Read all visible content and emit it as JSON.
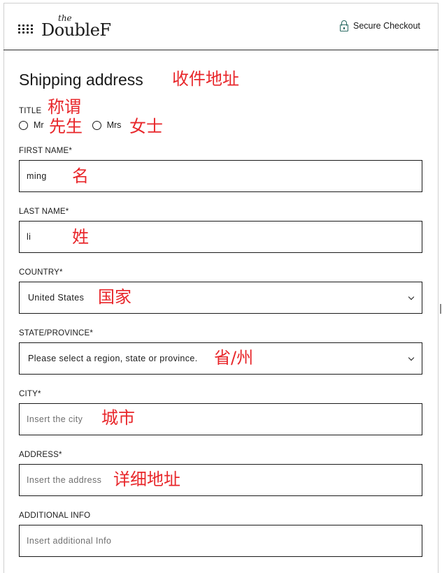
{
  "header": {
    "logo_the": "the",
    "logo_main": "DoubleF",
    "secure_label": "Secure Checkout",
    "icons": [
      "menu-dots-icon",
      "lock-icon"
    ]
  },
  "form": {
    "title": "Shipping address",
    "title_field": {
      "label": "TITLE",
      "options": [
        "Mr",
        "Mrs"
      ]
    },
    "first_name": {
      "label": "FIRST NAME*",
      "value": "ming"
    },
    "last_name": {
      "label": "LAST NAME*",
      "value": "li"
    },
    "country": {
      "label": "COUNTRY*",
      "value": "United States"
    },
    "state": {
      "label": "STATE/PROVINCE*",
      "value": "Please select a region, state or province."
    },
    "city": {
      "label": "CITY*",
      "placeholder": "Insert the city"
    },
    "address": {
      "label": "ADDRESS*",
      "placeholder": "Insert the address"
    },
    "additional": {
      "label": "ADDITIONAL INFO",
      "placeholder": "Insert additional Info"
    }
  },
  "annotations": {
    "title": "收件地址",
    "title_field": "称谓",
    "mr": "先生",
    "mrs": "女士",
    "first_name": "名",
    "last_name": "姓",
    "country": "国家",
    "state": "省/州",
    "city": "城市",
    "address": "详细地址"
  },
  "colors": {
    "annotation": "#e8262a",
    "lock": "#2a6a62",
    "border": "#1a1a1a"
  }
}
